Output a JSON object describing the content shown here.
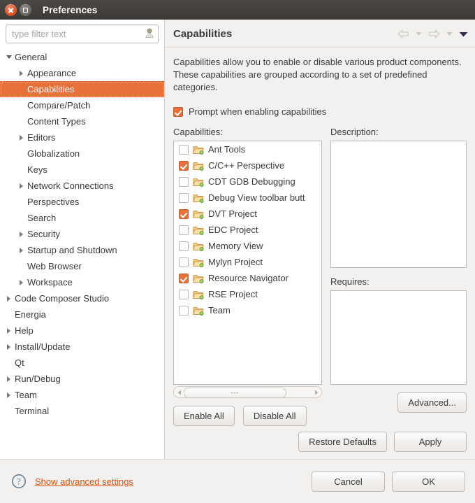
{
  "window": {
    "title": "Preferences",
    "close_icon": "close-icon",
    "maximize_icon": "maximize-icon"
  },
  "sidebar": {
    "filter": {
      "placeholder": "type filter text",
      "value": "",
      "icon": "filter-clear-icon"
    },
    "items": [
      {
        "label": "General",
        "indent": 0,
        "expander": "down",
        "selected": false
      },
      {
        "label": "Appearance",
        "indent": 1,
        "expander": "right",
        "selected": false
      },
      {
        "label": "Capabilities",
        "indent": 1,
        "expander": "none",
        "selected": true
      },
      {
        "label": "Compare/Patch",
        "indent": 1,
        "expander": "none",
        "selected": false
      },
      {
        "label": "Content Types",
        "indent": 1,
        "expander": "none",
        "selected": false
      },
      {
        "label": "Editors",
        "indent": 1,
        "expander": "right",
        "selected": false
      },
      {
        "label": "Globalization",
        "indent": 1,
        "expander": "none",
        "selected": false
      },
      {
        "label": "Keys",
        "indent": 1,
        "expander": "none",
        "selected": false
      },
      {
        "label": "Network Connections",
        "indent": 1,
        "expander": "right",
        "selected": false
      },
      {
        "label": "Perspectives",
        "indent": 1,
        "expander": "none",
        "selected": false
      },
      {
        "label": "Search",
        "indent": 1,
        "expander": "none",
        "selected": false
      },
      {
        "label": "Security",
        "indent": 1,
        "expander": "right",
        "selected": false
      },
      {
        "label": "Startup and Shutdown",
        "indent": 1,
        "expander": "right",
        "selected": false
      },
      {
        "label": "Web Browser",
        "indent": 1,
        "expander": "none",
        "selected": false
      },
      {
        "label": "Workspace",
        "indent": 1,
        "expander": "right",
        "selected": false
      },
      {
        "label": "Code Composer Studio",
        "indent": 0,
        "expander": "right",
        "selected": false
      },
      {
        "label": "Energia",
        "indent": 0,
        "expander": "none",
        "selected": false
      },
      {
        "label": "Help",
        "indent": 0,
        "expander": "right",
        "selected": false
      },
      {
        "label": "Install/Update",
        "indent": 0,
        "expander": "right",
        "selected": false
      },
      {
        "label": "Qt",
        "indent": 0,
        "expander": "none",
        "selected": false
      },
      {
        "label": "Run/Debug",
        "indent": 0,
        "expander": "right",
        "selected": false
      },
      {
        "label": "Team",
        "indent": 0,
        "expander": "right",
        "selected": false
      },
      {
        "label": "Terminal",
        "indent": 0,
        "expander": "none",
        "selected": false
      }
    ]
  },
  "page": {
    "title": "Capabilities",
    "description": "Capabilities allow you to enable or disable various product components. These capabilities are grouped according to a set of predefined categories.",
    "nav": {
      "back_icon": "back-arrow-icon",
      "back_menu_icon": "chevron-down-icon",
      "forward_icon": "forward-arrow-icon",
      "forward_menu_icon": "chevron-down-icon",
      "menu_icon": "view-menu-icon"
    },
    "prompt_checkbox": {
      "label": "Prompt when enabling capabilities",
      "checked": true
    },
    "capabilities_label": "Capabilities:",
    "description_label": "Description:",
    "requires_label": "Requires:",
    "description_value": "",
    "requires_value": "",
    "capabilities": [
      {
        "label": "Ant Tools",
        "checked": false
      },
      {
        "label": "C/C++ Perspective",
        "checked": true
      },
      {
        "label": "CDT GDB Debugging",
        "checked": false
      },
      {
        "label": "Debug View toolbar butt",
        "checked": false
      },
      {
        "label": "DVT Project",
        "checked": true
      },
      {
        "label": "EDC Project",
        "checked": false
      },
      {
        "label": "Memory View",
        "checked": false
      },
      {
        "label": "Mylyn Project",
        "checked": false
      },
      {
        "label": "Resource Navigator",
        "checked": true
      },
      {
        "label": "RSE Project",
        "checked": false
      },
      {
        "label": "Team",
        "checked": false
      }
    ],
    "buttons": {
      "enable_all": "Enable All",
      "disable_all": "Disable All",
      "advanced": "Advanced...",
      "restore_defaults": "Restore Defaults",
      "apply": "Apply"
    }
  },
  "footer": {
    "help_icon": "help-question-icon",
    "advanced_link": "Show advanced settings",
    "cancel": "Cancel",
    "ok": "OK"
  },
  "colors": {
    "accent": "#e8703a",
    "link": "#d9500f",
    "titlebar": "#3c3937",
    "window_bg": "#f2f1f0"
  }
}
